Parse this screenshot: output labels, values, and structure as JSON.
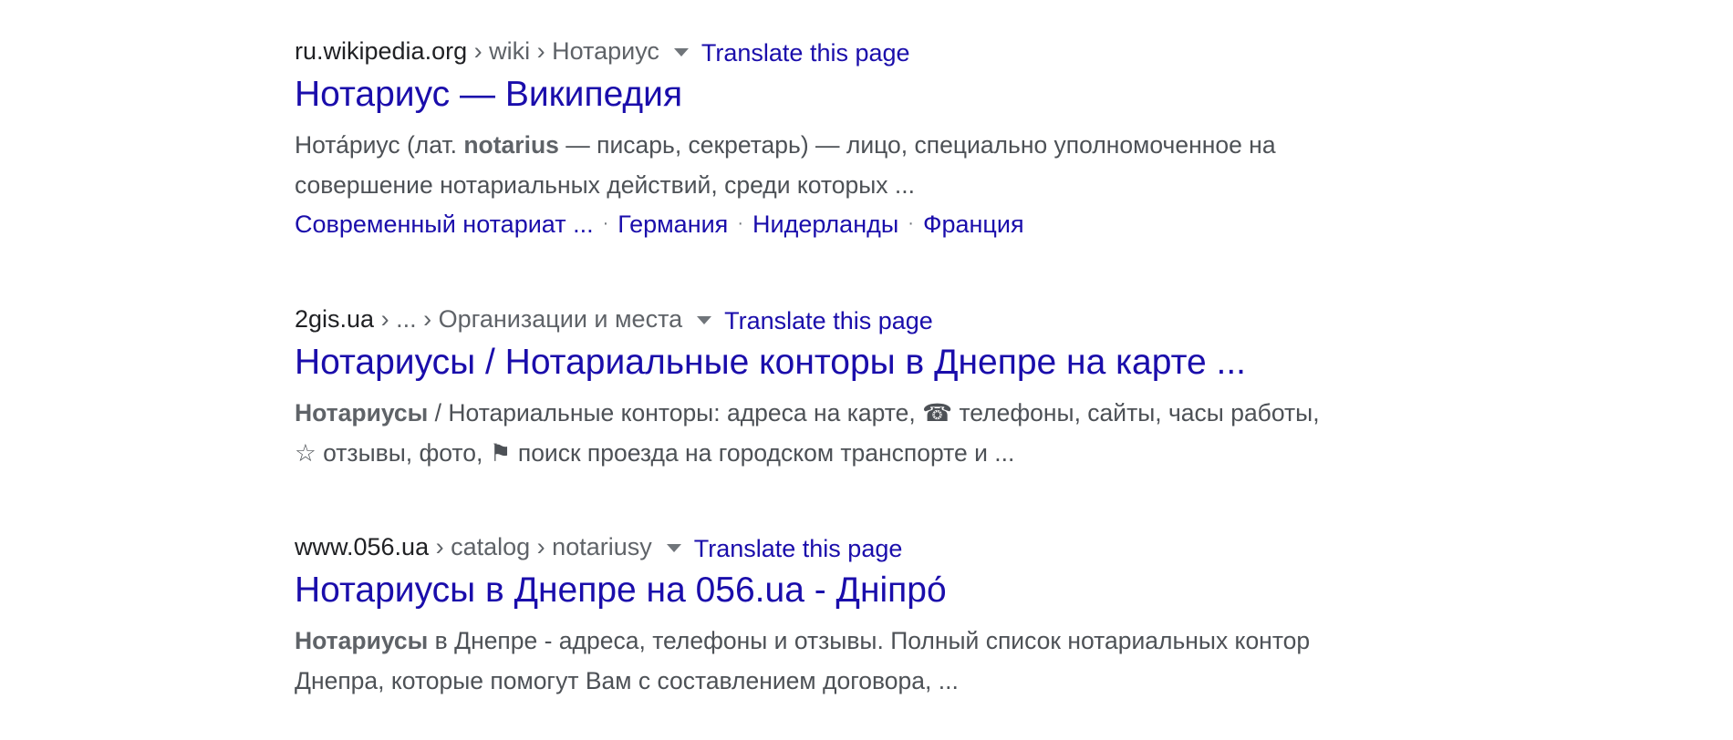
{
  "results": [
    {
      "domain": "ru.wikipedia.org",
      "path": [
        "wiki",
        "Нотариус"
      ],
      "translate_label": "Translate this page",
      "title": "Нотариус — Википедия",
      "snippet": {
        "pre": "Нота́риус (лат. ",
        "bold": "notarius",
        "line1_rest": " — писарь, секретарь) — лицо, специально уполномоченное на",
        "line2": "совершение нотариальных действий, среди которых ..."
      },
      "sitelinks": [
        "Современный нотариат ...",
        "Германия",
        "Нидерланды",
        "Франция"
      ]
    },
    {
      "domain": "2gis.ua",
      "path": [
        "...",
        "Организации и места"
      ],
      "translate_label": "Translate this page",
      "title": "Нотариусы / Нотариальные конторы в Днепре на карте ...",
      "snippet": {
        "bold": "Нотариусы",
        "line1_rest": " / Нотариальные конторы: адреса на карте, ☎ телефоны, сайты, часы работы,",
        "line2": "☆ отзывы, фото, ⚑ поиск проезда на городском транспорте и ..."
      }
    },
    {
      "domain": "www.056.ua",
      "path": [
        "catalog",
        "notariusy"
      ],
      "translate_label": "Translate this page",
      "title": "Нотариусы в Днепре на 056.ua - Дніпро́",
      "snippet": {
        "bold": "Нотариусы",
        "line1_rest": " в Днепре - адреса, телефоны и отзывы. Полный список нотариальных контор",
        "line2": "Днепра, которые помогут Вам с составлением договора, ..."
      }
    }
  ],
  "separator": " › ",
  "sitelink_dot": "·"
}
